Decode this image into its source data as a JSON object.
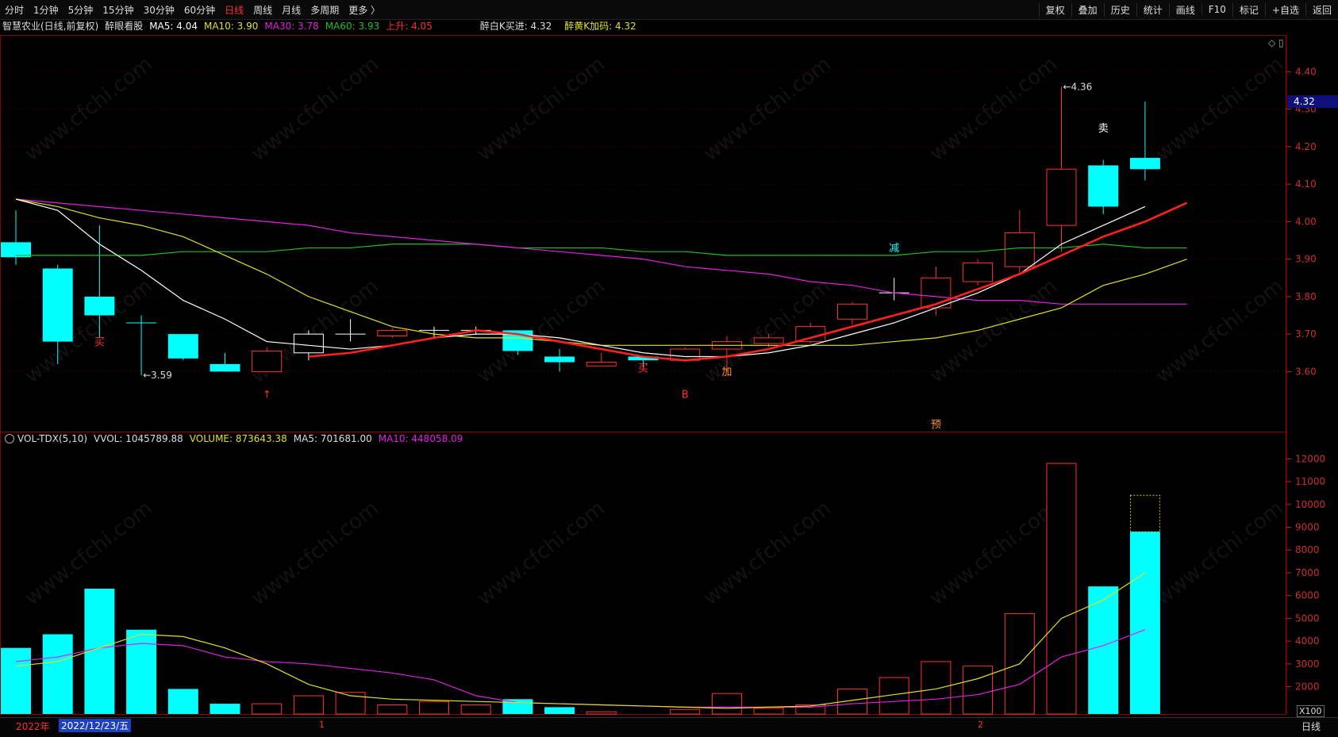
{
  "toolbar": {
    "left_items": [
      "分时",
      "1分钟",
      "5分钟",
      "15分钟",
      "30分钟",
      "60分钟",
      "日线",
      "周线",
      "月线",
      "多周期",
      "更多 〉"
    ],
    "active": "日线",
    "right_items": [
      "复权",
      "叠加",
      "历史",
      "统计",
      "画线",
      "F10",
      "标记",
      "+自选",
      "返回"
    ]
  },
  "legend": {
    "title": "智慧农业(日线,前复权)",
    "indicator": "醉眼看股",
    "ma5": "MA5: 4.04",
    "ma10": "MA10: 3.90",
    "ma30": "MA30: 3.78",
    "ma60": "MA60: 3.93",
    "up": "上升: 4.05",
    "buy": "醉白K买进: 4.32",
    "add": "醉黄K加码: 4.32"
  },
  "vol_legend": {
    "name": "VOL-TDX(5,10)",
    "vvol": "VVOL: 1045789.88",
    "volume": "VOLUME: 873643.38",
    "ma5": "MA5: 701681.00",
    "ma10": "MA10: 448058.09"
  },
  "bottom": {
    "year_tag": "2022年",
    "date_tag": "2022/12/23/五",
    "tick_1": "1",
    "tick_2": "2",
    "right_tag": "日线",
    "unit_tag": "X100"
  },
  "price_axis": {
    "ticks": [
      "4.40",
      "4.30",
      "4.20",
      "4.10",
      "4.00",
      "3.90",
      "3.80",
      "3.70",
      "3.60"
    ],
    "current": "4.32"
  },
  "vol_axis": {
    "ticks": [
      "12000",
      "11000",
      "10000",
      "9000",
      "8000",
      "7000",
      "6000",
      "5000",
      "4000",
      "3000",
      "2000"
    ]
  },
  "watermark": "www.cfchi.com",
  "colors": {
    "up": "#ff3030",
    "down": "#00ffff",
    "ma5": "#ffffff",
    "ma10": "#e0e020",
    "ma30": "#e020e0",
    "ma60": "#20c020",
    "rise": "#ff2020"
  },
  "chart_data": {
    "type": "candlestick",
    "annotations": [
      {
        "text": "买",
        "i": 2,
        "y": 3.67,
        "color": "#ff3030"
      },
      {
        "text": "↑",
        "i": 6,
        "y": 3.53,
        "color": "#ff3030"
      },
      {
        "text": "买",
        "i": 15,
        "y": 3.6,
        "color": "#ff3030"
      },
      {
        "text": "B",
        "i": 16,
        "y": 3.53,
        "color": "#ff3030"
      },
      {
        "text": "加",
        "i": 17,
        "y": 3.59,
        "color": "#ff9020"
      },
      {
        "text": "减",
        "i": 21,
        "y": 3.92,
        "color": "#00ffff"
      },
      {
        "text": "卖",
        "i": 26,
        "y": 4.24,
        "color": "#ffffff"
      },
      {
        "text": "预",
        "i": 22,
        "y": 3.45,
        "color": "#ff9020"
      }
    ],
    "labels": [
      {
        "text": "←3.59",
        "i": 3,
        "y": 3.59
      },
      {
        "text": "←4.36",
        "i": 25,
        "y": 4.36
      }
    ],
    "candles": [
      {
        "o": 3.905,
        "c": 3.945,
        "h": 4.03,
        "l": 3.885,
        "up": false
      },
      {
        "o": 3.875,
        "c": 3.68,
        "h": 3.885,
        "l": 3.62,
        "up": false
      },
      {
        "o": 3.8,
        "c": 3.75,
        "h": 3.99,
        "l": 3.69,
        "up": false
      },
      {
        "o": 3.73,
        "c": 3.73,
        "h": 3.75,
        "l": 3.59,
        "up": false,
        "cross": true
      },
      {
        "o": 3.7,
        "c": 3.635,
        "h": 3.7,
        "l": 3.63,
        "up": false
      },
      {
        "o": 3.62,
        "c": 3.6,
        "h": 3.65,
        "l": 3.6,
        "up": false
      },
      {
        "o": 3.6,
        "c": 3.655,
        "h": 3.665,
        "l": 3.6,
        "up": true
      },
      {
        "o": 3.65,
        "c": 3.7,
        "h": 3.71,
        "l": 3.63,
        "up": true,
        "white": true
      },
      {
        "o": 3.7,
        "c": 3.7,
        "h": 3.74,
        "l": 3.68,
        "up": true,
        "cross": true,
        "white": true
      },
      {
        "o": 3.695,
        "c": 3.71,
        "h": 3.715,
        "l": 3.69,
        "up": true
      },
      {
        "o": 3.71,
        "c": 3.71,
        "h": 3.72,
        "l": 3.69,
        "up": true,
        "cross": true,
        "white": true
      },
      {
        "o": 3.71,
        "c": 3.71,
        "h": 3.72,
        "l": 3.7,
        "up": true,
        "cross": true,
        "white": true
      },
      {
        "o": 3.71,
        "c": 3.655,
        "h": 3.71,
        "l": 3.645,
        "up": false
      },
      {
        "o": 3.64,
        "c": 3.625,
        "h": 3.66,
        "l": 3.6,
        "up": false
      },
      {
        "o": 3.625,
        "c": 3.615,
        "h": 3.65,
        "l": 3.615,
        "up": true
      },
      {
        "o": 3.64,
        "c": 3.63,
        "h": 3.64,
        "l": 3.61,
        "up": false
      },
      {
        "o": 3.63,
        "c": 3.66,
        "h": 3.665,
        "l": 3.625,
        "up": true
      },
      {
        "o": 3.66,
        "c": 3.68,
        "h": 3.695,
        "l": 3.6,
        "up": true
      },
      {
        "o": 3.675,
        "c": 3.69,
        "h": 3.7,
        "l": 3.665,
        "up": true
      },
      {
        "o": 3.68,
        "c": 3.72,
        "h": 3.73,
        "l": 3.675,
        "up": true
      },
      {
        "o": 3.74,
        "c": 3.78,
        "h": 3.785,
        "l": 3.725,
        "up": true
      },
      {
        "o": 3.81,
        "c": 3.81,
        "h": 3.85,
        "l": 3.79,
        "up": true,
        "cross": true,
        "white": true
      },
      {
        "o": 3.77,
        "c": 3.85,
        "h": 3.88,
        "l": 3.75,
        "up": true
      },
      {
        "o": 3.84,
        "c": 3.89,
        "h": 3.9,
        "l": 3.83,
        "up": true
      },
      {
        "o": 3.88,
        "c": 3.97,
        "h": 4.03,
        "l": 3.86,
        "up": true
      },
      {
        "o": 3.99,
        "c": 4.14,
        "h": 4.36,
        "l": 3.92,
        "up": true
      },
      {
        "o": 4.15,
        "c": 4.04,
        "h": 4.165,
        "l": 4.02,
        "up": false
      },
      {
        "o": 4.17,
        "c": 4.14,
        "h": 4.32,
        "l": 4.11,
        "up": false
      }
    ],
    "ma5": [
      4.06,
      4.03,
      3.94,
      3.87,
      3.79,
      3.74,
      3.68,
      3.67,
      3.66,
      3.67,
      3.69,
      3.7,
      3.7,
      3.69,
      3.67,
      3.65,
      3.64,
      3.64,
      3.65,
      3.67,
      3.7,
      3.73,
      3.77,
      3.81,
      3.86,
      3.94,
      3.99,
      4.04
    ],
    "ma10": [
      4.06,
      4.04,
      4.01,
      3.99,
      3.96,
      3.91,
      3.86,
      3.8,
      3.76,
      3.72,
      3.7,
      3.69,
      3.69,
      3.68,
      3.67,
      3.67,
      3.67,
      3.67,
      3.67,
      3.67,
      3.67,
      3.68,
      3.69,
      3.71,
      3.74,
      3.77,
      3.83,
      3.86,
      3.9
    ],
    "ma30": [
      4.06,
      4.05,
      4.04,
      4.03,
      4.02,
      4.01,
      4.0,
      3.99,
      3.97,
      3.96,
      3.95,
      3.94,
      3.93,
      3.92,
      3.91,
      3.9,
      3.88,
      3.87,
      3.86,
      3.84,
      3.83,
      3.81,
      3.8,
      3.79,
      3.79,
      3.78,
      3.78,
      3.78,
      3.78
    ],
    "ma60": [
      3.91,
      3.91,
      3.91,
      3.91,
      3.92,
      3.92,
      3.92,
      3.93,
      3.93,
      3.94,
      3.94,
      3.94,
      3.93,
      3.93,
      3.93,
      3.92,
      3.92,
      3.91,
      3.91,
      3.91,
      3.91,
      3.91,
      3.92,
      3.92,
      3.93,
      3.93,
      3.94,
      3.93,
      3.93
    ],
    "rise": [
      null,
      null,
      null,
      null,
      null,
      null,
      null,
      3.64,
      3.65,
      3.67,
      3.69,
      3.71,
      3.7,
      3.68,
      3.66,
      3.64,
      3.63,
      3.64,
      3.66,
      3.69,
      3.72,
      3.75,
      3.78,
      3.82,
      3.86,
      3.91,
      3.96,
      4.0,
      4.05
    ],
    "volume": [
      3700,
      4300,
      6300,
      4500,
      1900,
      1250,
      1250,
      1600,
      1750,
      1200,
      1350,
      1200,
      1450,
      1100,
      900,
      800,
      1000,
      1700,
      1050,
      1200,
      1900,
      2400,
      3100,
      2900,
      5200,
      11800,
      6400,
      8800
    ],
    "volume_top": [
      null,
      null,
      null,
      null,
      null,
      null,
      null,
      null,
      null,
      null,
      null,
      null,
      null,
      null,
      null,
      null,
      null,
      null,
      null,
      null,
      null,
      null,
      null,
      null,
      null,
      null,
      null,
      10400
    ],
    "vol_ma5": [
      2900,
      3100,
      3700,
      4300,
      4200,
      3700,
      3000,
      2100,
      1600,
      1450,
      1400,
      1350,
      1300,
      1250,
      1200,
      1150,
      1100,
      1050,
      1100,
      1150,
      1400,
      1650,
      1900,
      2350,
      3000,
      5000,
      5800,
      7000
    ],
    "vol_ma10": [
      3100,
      3300,
      3700,
      3900,
      3800,
      3300,
      3100,
      3000,
      2800,
      2600,
      2300,
      1600,
      1300,
      1250,
      1200,
      1150,
      1100,
      1100,
      1100,
      1100,
      1250,
      1350,
      1450,
      1650,
      2100,
      3300,
      3800,
      4500
    ],
    "price_range": [
      3.44,
      4.46
    ],
    "volume_range": [
      800,
      12500
    ]
  }
}
